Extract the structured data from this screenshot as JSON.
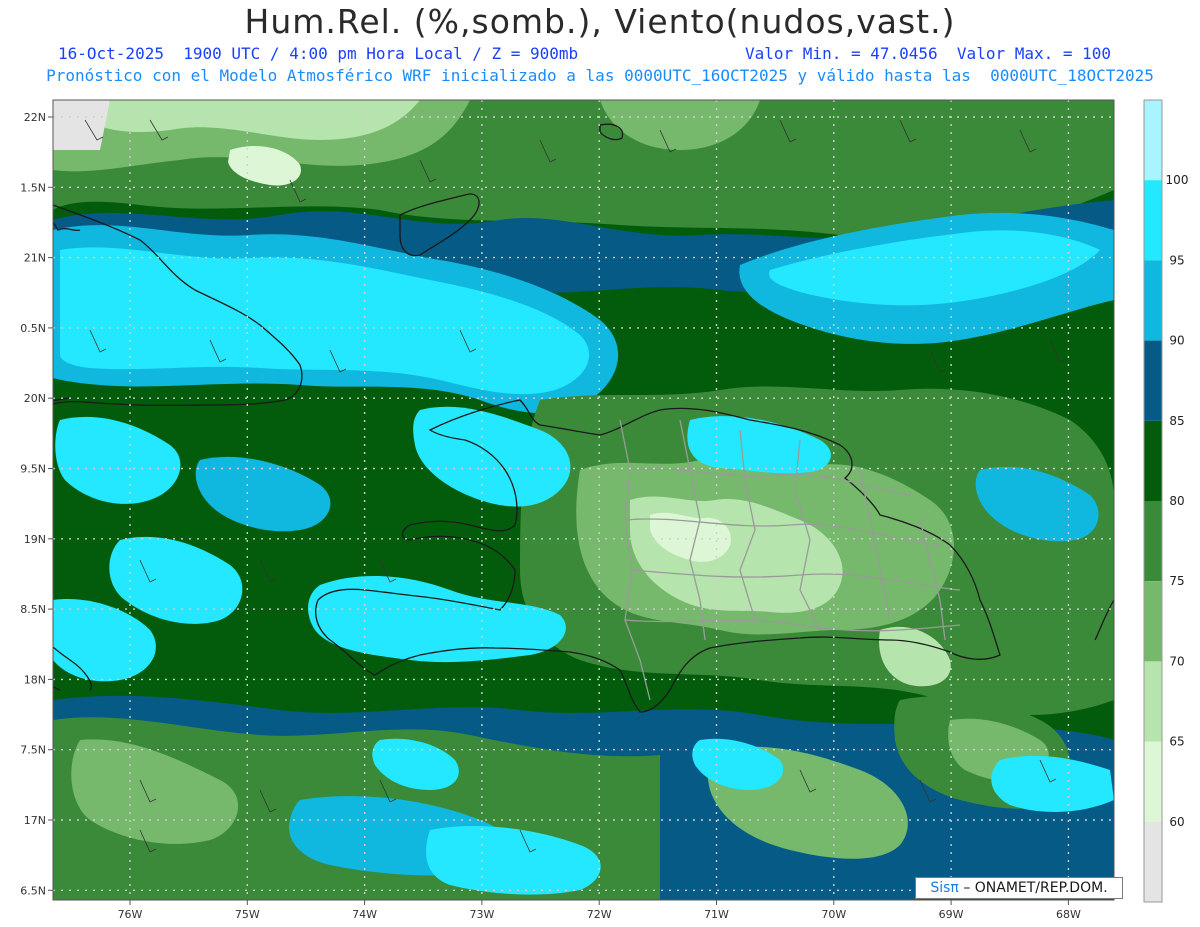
{
  "title": "Hum.Rel. (%,somb.), Viento(nudos,vast.)",
  "subtitle_left": "16-Oct-2025  1900 UTC / 4:00 pm Hora Local / Z = 900mb",
  "subtitle_right": "Valor Min. = 47.0456  Valor Max. = 100",
  "subtitle_2": "Pronóstico con el Modelo Atmosférico WRF inicializado a las 0000UTC_16OCT2025 y válido hasta las  0000UTC_18OCT2025",
  "lat_labels": [
    "22N",
    "1.5N",
    "21N",
    "0.5N",
    "20N",
    "9.5N",
    "19N",
    "8.5N",
    "18N",
    "7.5N",
    "17N",
    "6.5N"
  ],
  "lon_labels": [
    "76W",
    "75W",
    "74W",
    "73W",
    "72W",
    "71W",
    "70W",
    "69W",
    "68W"
  ],
  "colorbar": {
    "labels": [
      "100",
      "95",
      "90",
      "85",
      "80",
      "75",
      "70",
      "65",
      "60"
    ],
    "colors": [
      "#a8f4ff",
      "#24e8ff",
      "#10b8e0",
      "#055a86",
      "#035c0c",
      "#3b8a3a",
      "#76b96c",
      "#b6e4ad",
      "#dcf6d6",
      "#e4e4e4"
    ]
  },
  "credit": {
    "brand": "Sisπ",
    "text": "– ONAMET/REP.DOM."
  }
}
